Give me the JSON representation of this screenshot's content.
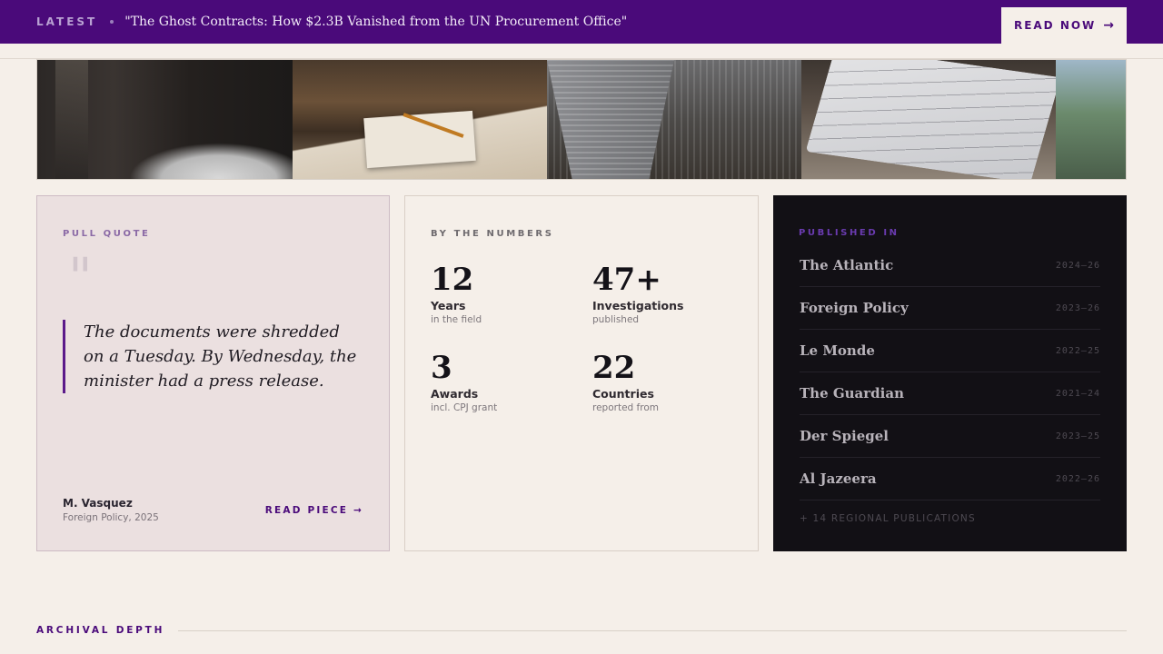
{
  "banner": {
    "latest_label": "LATEST",
    "headline": "\"The Ghost Contracts: How $2.3B Vanished from the UN Procurement Office\"",
    "cta_label": "READ NOW",
    "cta_icon": "arrow-right-icon",
    "background_color": "#4a0a7a"
  },
  "photo_strip": [
    {
      "name": "bedroom"
    },
    {
      "name": "desk"
    },
    {
      "name": "city"
    },
    {
      "name": "notebook"
    },
    {
      "name": "window"
    }
  ],
  "pull_quote": {
    "eyebrow": "PULL QUOTE",
    "mark": "\"",
    "text": "The documents were shredded on a Tuesday. By Wednesday, the minister had a press release.",
    "author": "M. Vasquez",
    "source": "Foreign Policy, 2025",
    "link_label": "READ PIECE →",
    "accent_color": "#5b1a8a"
  },
  "numbers": {
    "eyebrow": "BY THE NUMBERS",
    "stats": [
      {
        "value": "12",
        "label": "Years",
        "sub": "in the field"
      },
      {
        "value": "47+",
        "label": "Investigations",
        "sub": "published"
      },
      {
        "value": "3",
        "label": "Awards",
        "sub": "incl. CPJ grant"
      },
      {
        "value": "22",
        "label": "Countries",
        "sub": "reported from"
      }
    ]
  },
  "published_in": {
    "eyebrow": "PUBLISHED IN",
    "items": [
      {
        "name": "The Atlantic",
        "years": "2024–26"
      },
      {
        "name": "Foreign Policy",
        "years": "2023–26"
      },
      {
        "name": "Le Monde",
        "years": "2022–25"
      },
      {
        "name": "The Guardian",
        "years": "2021–24"
      },
      {
        "name": "Der Spiegel",
        "years": "2023–25"
      },
      {
        "name": "Al Jazeera",
        "years": "2022–26"
      }
    ],
    "more_label": "+ 14 REGIONAL PUBLICATIONS",
    "background_color": "#121015"
  },
  "section": {
    "label": "ARCHIVAL DEPTH"
  }
}
